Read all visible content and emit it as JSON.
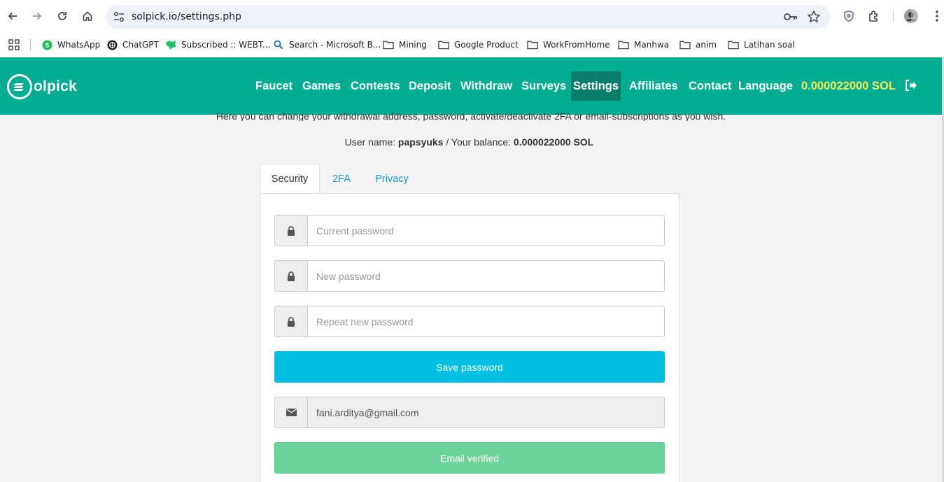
{
  "browser": {
    "url": "solpick.io/settings.php",
    "bookmarks": [
      {
        "label": "WhatsApp",
        "icon": "whatsapp-icon"
      },
      {
        "label": "ChatGPT",
        "icon": "chatgpt-icon"
      },
      {
        "label": "Subscribed :: WEBT...",
        "icon": "webtoon-icon"
      },
      {
        "label": "Search - Microsoft B...",
        "icon": "search-icon"
      },
      {
        "label": "Mining",
        "icon": "folder-icon"
      },
      {
        "label": "Google Product",
        "icon": "folder-icon"
      },
      {
        "label": "WorkFromHome",
        "icon": "folder-icon"
      },
      {
        "label": "Manhwa",
        "icon": "folder-icon"
      },
      {
        "label": "anim",
        "icon": "folder-icon"
      },
      {
        "label": "Latihan soal",
        "icon": "folder-icon"
      }
    ]
  },
  "site": {
    "logo_text": "olpick",
    "nav": [
      "Faucet",
      "Games",
      "Contests",
      "Deposit",
      "Withdraw",
      "Surveys",
      "Settings",
      "Affiliates",
      "Contact",
      "Language"
    ],
    "active_nav": "Settings",
    "balance": "0.000022000 SOL",
    "colors": {
      "navbar": "#00ac92",
      "active": "#0b7e6b",
      "balance": "#f5ef5a",
      "save": "#00bfe0",
      "verified": "#6bd49a"
    }
  },
  "settings": {
    "intro": "Here you can change your withdrawal address, password, activate/deactivate 2FA or email-subscriptions as you wish.",
    "user_label": "User name:",
    "username": "papsyuks",
    "balance_label": "/ Your balance:",
    "balance": "0.000022000 SOL",
    "tabs": [
      "Security",
      "2FA",
      "Privacy"
    ],
    "active_tab": "Security",
    "current_password_placeholder": "Current password",
    "new_password_placeholder": "New password",
    "repeat_password_placeholder": "Repeat new password",
    "save_button": "Save password",
    "email": "fani.arditya@gmail.com",
    "email_status": "Email verified"
  }
}
